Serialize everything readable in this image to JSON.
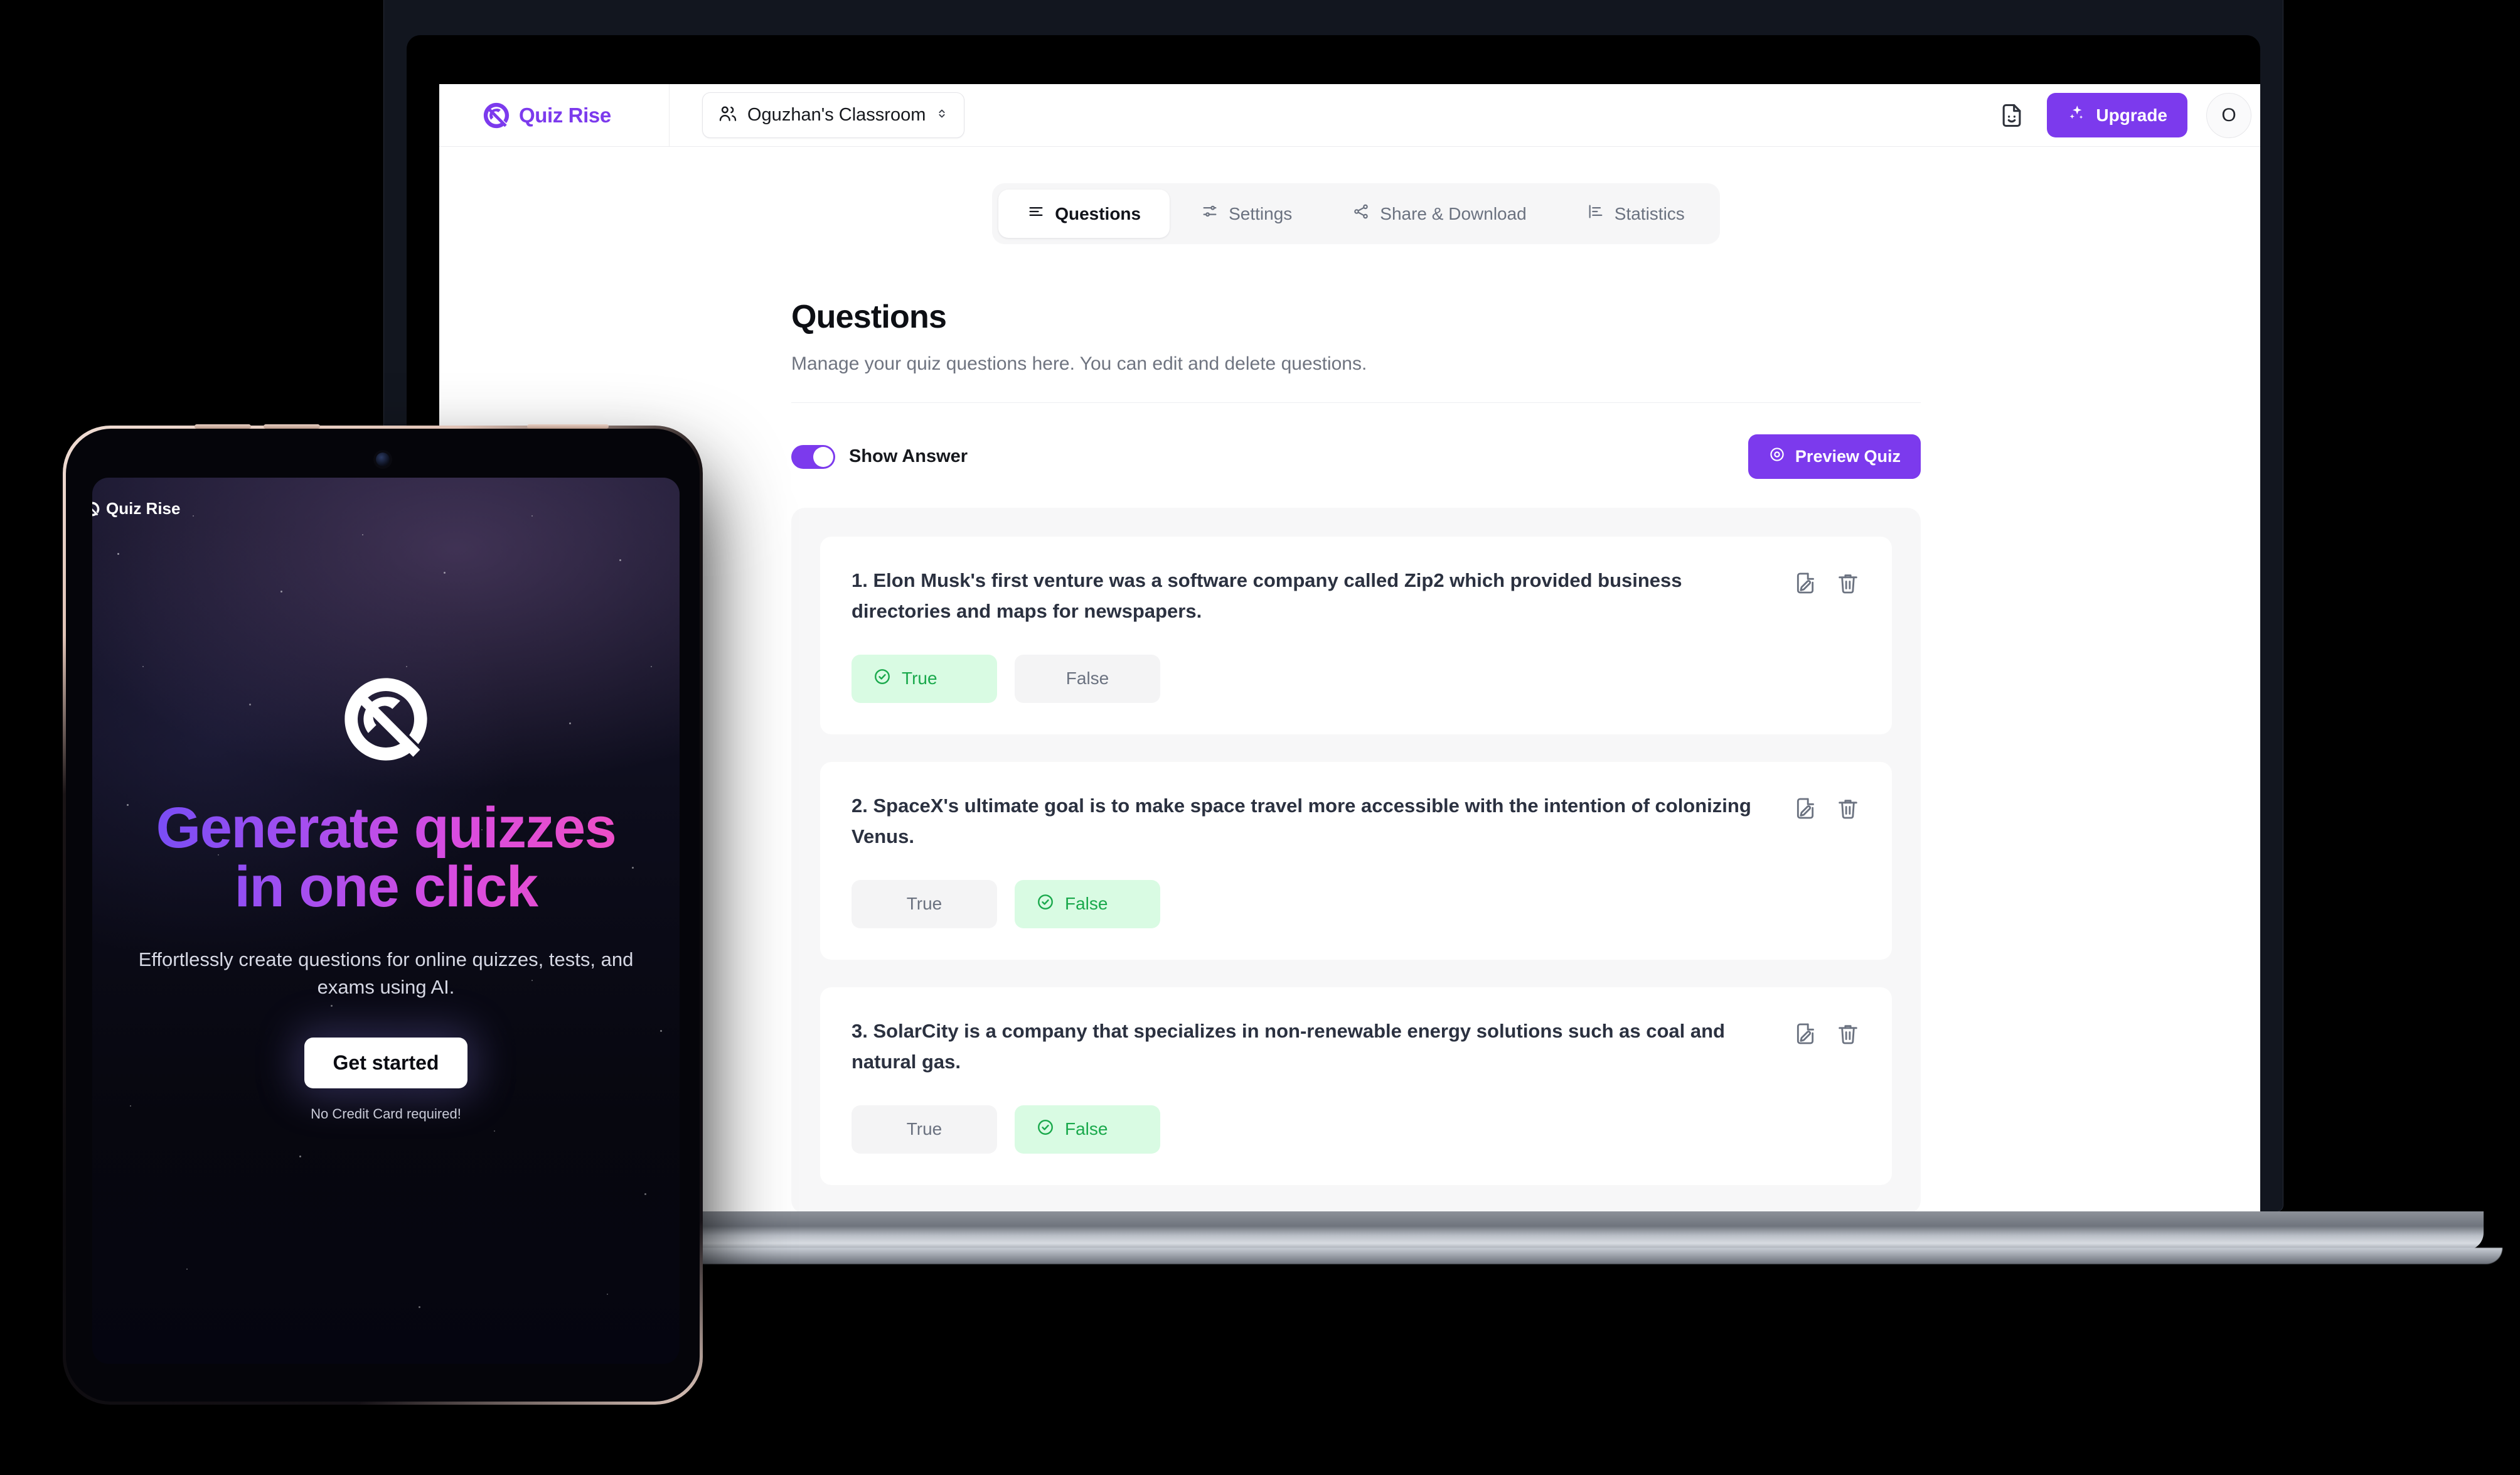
{
  "app": {
    "brand_name": "Quiz Rise",
    "brand_logo_icon": "quiz-rise-logo-icon"
  },
  "topbar": {
    "classroom_label": "Oguzhan's Classroom",
    "classroom_icon": "users-icon",
    "classroom_chevron_icon": "chevron-up-down-icon",
    "doc_icon": "document-smile-icon",
    "upgrade_label": "Upgrade",
    "upgrade_icon": "sparkles-icon",
    "avatar_initial": "O",
    "accent_color": "#7c3aed"
  },
  "tabs": [
    {
      "label": "Questions",
      "icon": "list-lines-icon",
      "active": true
    },
    {
      "label": "Settings",
      "icon": "sliders-icon",
      "active": false
    },
    {
      "label": "Share & Download",
      "icon": "share-nodes-icon",
      "active": false
    },
    {
      "label": "Statistics",
      "icon": "bar-chart-icon",
      "active": false
    }
  ],
  "panel": {
    "title": "Questions",
    "subtitle": "Manage your quiz questions here. You can edit and delete questions."
  },
  "controls": {
    "toggle_label": "Show Answer",
    "toggle_on": true,
    "preview_label": "Preview Quiz",
    "preview_icon": "eye-icon"
  },
  "questions": [
    {
      "text": "1. Elon Musk's first venture was a software company called Zip2 which provided business directories and maps for newspapers.",
      "edit_icon": "edit-document-icon",
      "delete_icon": "trash-icon",
      "options": [
        {
          "label": "True",
          "correct": true,
          "icon": "check-circle-icon"
        },
        {
          "label": "False",
          "correct": false,
          "icon": ""
        }
      ]
    },
    {
      "text": "2. SpaceX's ultimate goal is to make space travel more accessible with the intention of colonizing Venus.",
      "edit_icon": "edit-document-icon",
      "delete_icon": "trash-icon",
      "options": [
        {
          "label": "True",
          "correct": false,
          "icon": ""
        },
        {
          "label": "False",
          "correct": true,
          "icon": "check-circle-icon"
        }
      ]
    },
    {
      "text": "3. SolarCity is a company that specializes in non-renewable energy solutions such as coal and natural gas.",
      "edit_icon": "edit-document-icon",
      "delete_icon": "trash-icon",
      "options": [
        {
          "label": "True",
          "correct": false,
          "icon": ""
        },
        {
          "label": "False",
          "correct": true,
          "icon": "check-circle-icon"
        }
      ]
    }
  ],
  "tablet": {
    "brand_name": "Quiz Rise",
    "logo_icon": "quiz-rise-logo-icon",
    "headline_line1": "Generate quizzes",
    "headline_line2": "in one click",
    "subtitle": "Effortlessly create questions for online quizzes, tests, and exams using AI.",
    "cta_label": "Get started",
    "cta_note": "No Credit Card required!",
    "gradient_start": "#6d4df6",
    "gradient_end": "#f24fc0"
  }
}
